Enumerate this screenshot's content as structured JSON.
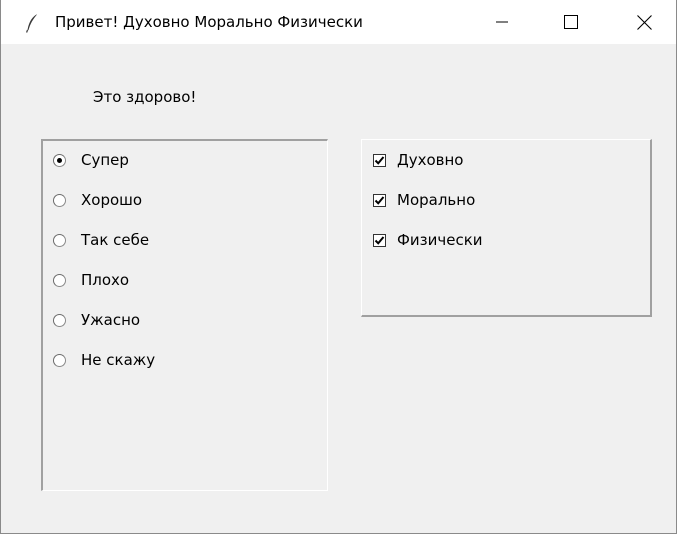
{
  "window": {
    "title": "Привет! Духовно Морально Физически",
    "app_icon": "feather-icon",
    "controls": [
      "minimize-icon",
      "maximize-icon",
      "close-icon"
    ]
  },
  "greeting": "Это здорово!",
  "radio_group": {
    "options": [
      "Супер",
      "Хорошо",
      "Так себе",
      "Плохо",
      "Ужасно",
      "Не скажу"
    ],
    "selected": "Супер"
  },
  "checkbox_group": {
    "items": [
      {
        "label": "Духовно",
        "checked": true
      },
      {
        "label": "Морально",
        "checked": true
      },
      {
        "label": "Физически",
        "checked": true
      }
    ]
  }
}
